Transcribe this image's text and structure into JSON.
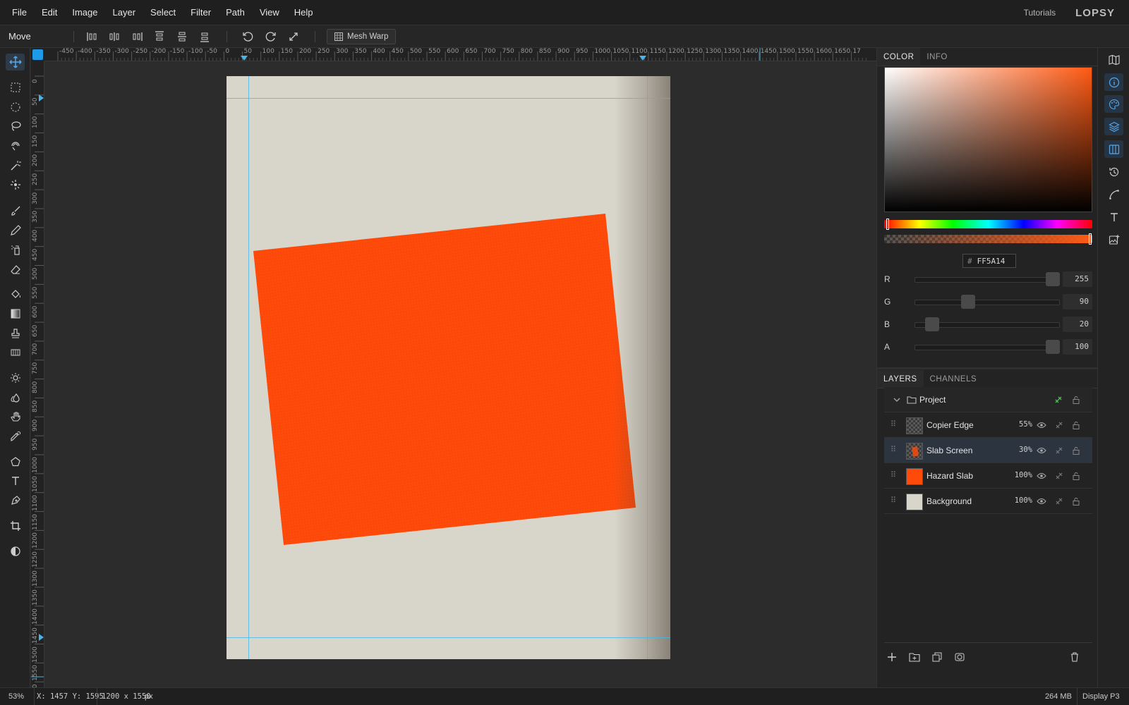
{
  "menubar": {
    "items": [
      "File",
      "Edit",
      "Image",
      "Layer",
      "Select",
      "Filter",
      "Path",
      "View",
      "Help"
    ],
    "tutorials": "Tutorials",
    "logo": "LOPSY"
  },
  "options": {
    "tool_name": "Move",
    "mesh_warp": "Mesh Warp"
  },
  "ruler": {
    "top_labels": [
      "-450",
      "-400",
      "-350",
      "-300",
      "-250",
      "-200",
      "-150",
      "-100",
      "-50",
      "0",
      "50",
      "100",
      "150",
      "200",
      "250",
      "300",
      "350",
      "400",
      "450",
      "500",
      "550",
      "600",
      "650",
      "700",
      "750",
      "800",
      "850",
      "900",
      "950",
      "1000",
      "1050",
      "1100",
      "1150",
      "1200",
      "1250",
      "1300",
      "1350",
      "1400",
      "1450",
      "1500",
      "1550",
      "1600",
      "1650",
      "17"
    ],
    "left_labels": [
      "0",
      "50",
      "100",
      "150",
      "200",
      "250",
      "300",
      "350",
      "400",
      "450",
      "500",
      "550",
      "600",
      "650",
      "700",
      "750",
      "800",
      "850",
      "900",
      "950",
      "1000",
      "1050",
      "1100",
      "1150",
      "1200",
      "1250",
      "1300",
      "1350",
      "1400",
      "1450",
      "1500",
      "1550",
      "00"
    ]
  },
  "canvas": {
    "document_color": "#d8d5cb",
    "slab_color": "#ff4a0a"
  },
  "color_panel": {
    "tabs": [
      "COLOR",
      "INFO"
    ],
    "hex_prefix": "#",
    "hex": "FF5A14",
    "channels": [
      {
        "label": "R",
        "value": "255",
        "fraction": 1.0
      },
      {
        "label": "G",
        "value": "90",
        "fraction": 0.353
      },
      {
        "label": "B",
        "value": "20",
        "fraction": 0.078
      },
      {
        "label": "A",
        "value": "100",
        "fraction": 1.0
      }
    ]
  },
  "layers_panel": {
    "tabs": [
      "LAYERS",
      "CHANNELS"
    ],
    "group_name": "Project",
    "layers": [
      {
        "name": "Copier Edge",
        "opacity": "55%",
        "thumb": "checker"
      },
      {
        "name": "Slab Screen",
        "opacity": "30%",
        "thumb": "checker-orange"
      },
      {
        "name": "Hazard Slab",
        "opacity": "100%",
        "thumb": "orange"
      },
      {
        "name": "Background",
        "opacity": "100%",
        "thumb": "paper"
      }
    ]
  },
  "status": {
    "zoom": "53%",
    "coords": "X: 1457 Y: 1595",
    "doc_size_value": "1200 x 1550",
    "doc_size_unit": "px",
    "memory": "264 MB",
    "color_profile": "Display P3"
  },
  "colors": {
    "accent": "#1e9be8",
    "guide": "#49b6e8",
    "current": "#ff5a14"
  }
}
